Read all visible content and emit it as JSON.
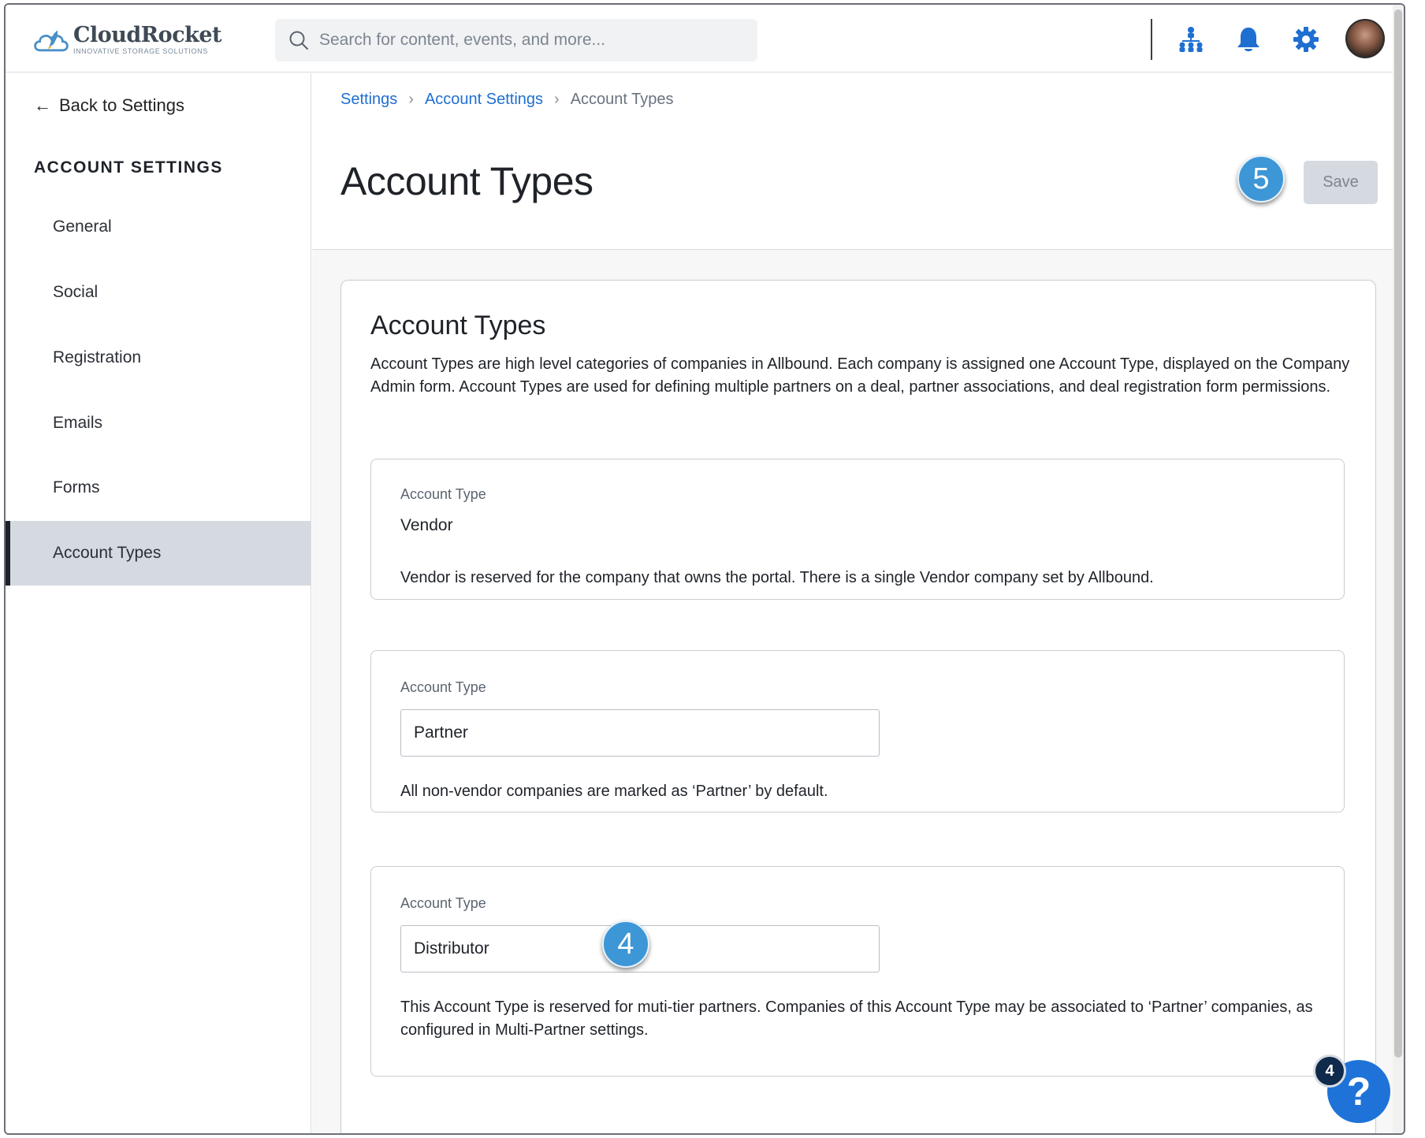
{
  "app": {
    "brand_name": "CloudRocket",
    "brand_tagline": "INNOVATIVE STORAGE SOLUTIONS"
  },
  "search": {
    "placeholder": "Search for content, events, and more..."
  },
  "topbar": {
    "icons": [
      "org-chart-icon",
      "bell-icon",
      "gear-icon"
    ],
    "accent_color": "#1f6fd1"
  },
  "sidebar": {
    "back_label": "Back to Settings",
    "heading": "ACCOUNT SETTINGS",
    "items": [
      {
        "label": "General"
      },
      {
        "label": "Social"
      },
      {
        "label": "Registration"
      },
      {
        "label": "Emails"
      },
      {
        "label": "Forms"
      },
      {
        "label": "Account Types",
        "active": true
      }
    ]
  },
  "breadcrumb": {
    "items": [
      "Settings",
      "Account Settings"
    ],
    "current": "Account Types"
  },
  "page": {
    "title": "Account Types",
    "save_label": "Save",
    "step_badge_save": "5",
    "step_badge_input": "4"
  },
  "card": {
    "title": "Account Types",
    "description": "Account Types are high level categories of companies in Allbound. Each company is assigned one Account Type, displayed on the Company Admin form. Account Types are used for defining multiple partners on a deal, partner associations, and deal registration form permissions.",
    "types": [
      {
        "label": "Account Type",
        "value": "Vendor",
        "editable": false,
        "note": "Vendor is reserved for the company that owns the portal. There is a single Vendor company set by Allbound."
      },
      {
        "label": "Account Type",
        "value": "Partner",
        "editable": true,
        "note": "All non-vendor companies are marked as ‘Partner’ by default."
      },
      {
        "label": "Account Type",
        "value": "Distributor",
        "editable": true,
        "note": "This Account Type is reserved for muti-tier partners. Companies of this Account Type may be associated to ‘Partner’ companies, as configured in Multi-Partner settings."
      }
    ]
  },
  "help": {
    "icon_label": "?",
    "count": "4"
  }
}
